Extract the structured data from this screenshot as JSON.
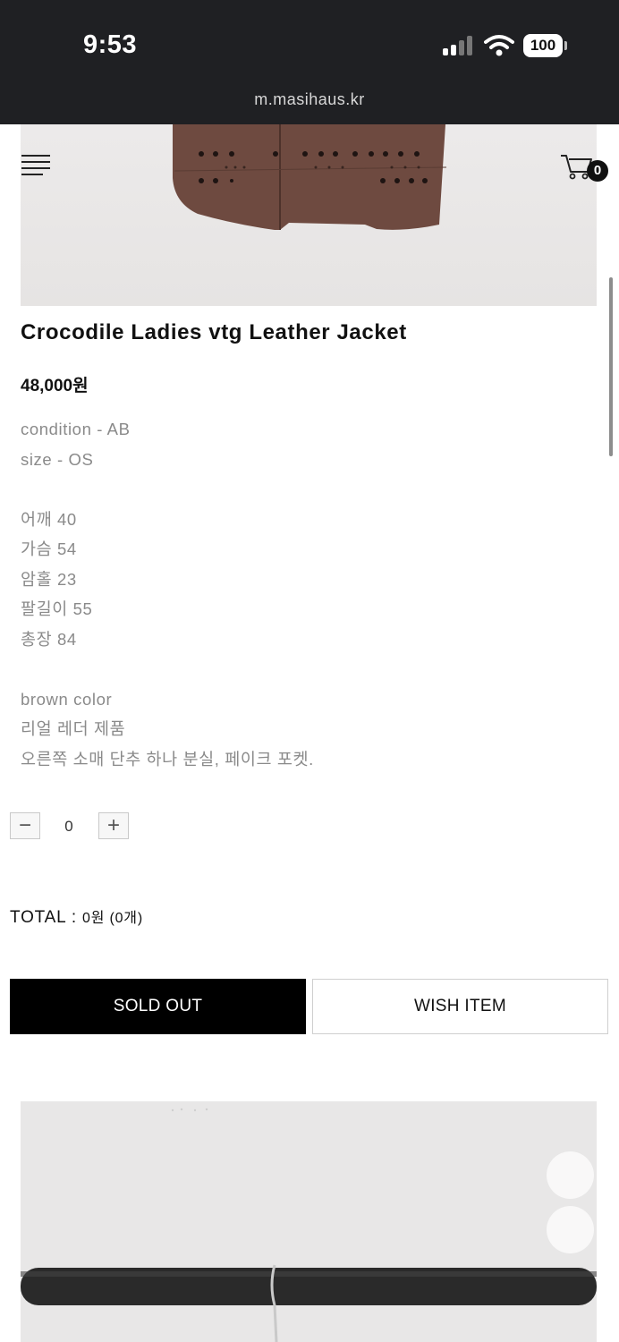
{
  "status_bar": {
    "time": "9:53",
    "battery": "100"
  },
  "browser": {
    "url": "m.masihaus.kr"
  },
  "header": {
    "cart_count": "0"
  },
  "product": {
    "title": "Crocodile Ladies vtg Leather Jacket",
    "price": "48,000원",
    "description": [
      "condition - AB",
      "size - OS",
      "",
      "어깨 40",
      "가슴 54",
      "암홀 23",
      "팔길이 55",
      "총장 84",
      "",
      "brown color",
      "리얼 레더 제품",
      "오른쪽 소매 단추 하나 분실, 페이크 포켓."
    ]
  },
  "quantity": {
    "minus": "−",
    "plus": "+",
    "value": "0"
  },
  "total": {
    "label": "TOTAL : ",
    "amount": "0원 (0개)"
  },
  "buttons": {
    "sold_out": "SOLD OUT",
    "wish": "WISH ITEM"
  },
  "colors": {
    "leather": "#6e4a40",
    "status_bar": "#1f2023",
    "button_dark": "#000000"
  },
  "icons": {
    "menu": "hamburger-icon",
    "cart": "cart-icon"
  }
}
